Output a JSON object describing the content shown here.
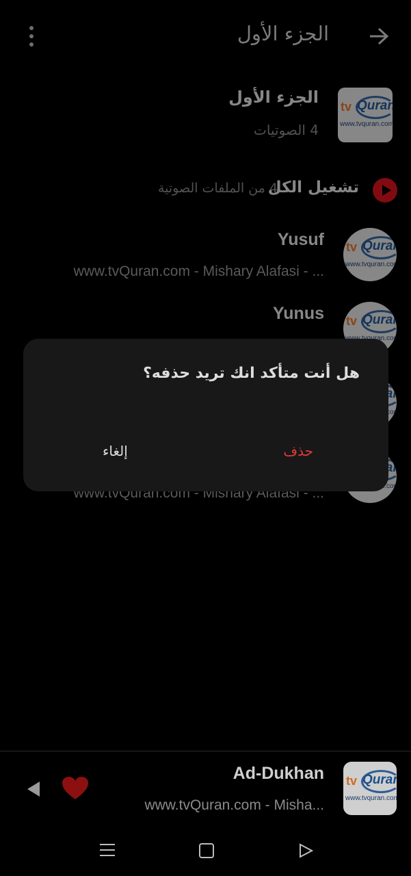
{
  "header": {
    "title": "الجزء الأول",
    "menu_icon": "more-vert-icon",
    "back_icon": "arrow-right-icon"
  },
  "album": {
    "title": "الجزء الأول",
    "count": "4 الصوتيات",
    "logo_tv": "tv",
    "logo_quran": "Quran",
    "logo_url": "www.tvquran.com"
  },
  "play_all": {
    "label": "تشغيل الكل",
    "count": "4 من الملفات الصوتية"
  },
  "tracks": [
    {
      "title": "Yusuf",
      "subtitle": "www.tvQuran.com - Mishary Alafasi - ..."
    },
    {
      "title": "Yunus",
      "subtitle": ""
    },
    {
      "title": "",
      "subtitle": ""
    },
    {
      "title": "",
      "subtitle": "www.tvQuran.com - Mishary Alafasi - ..."
    }
  ],
  "dialog": {
    "message": "هل أنت متأكد انك تريد حذفه؟",
    "delete_label": "حذف",
    "cancel_label": "إلغاء"
  },
  "player": {
    "title": "Ad-Dukhan",
    "subtitle": "www.tvQuran.com - Misha...",
    "prev_icon": "previous-icon",
    "heart_icon": "heart-icon"
  },
  "colors": {
    "accent_red": "#c6121a",
    "delete_red": "#e23a3a",
    "dialog_bg": "#181818"
  }
}
